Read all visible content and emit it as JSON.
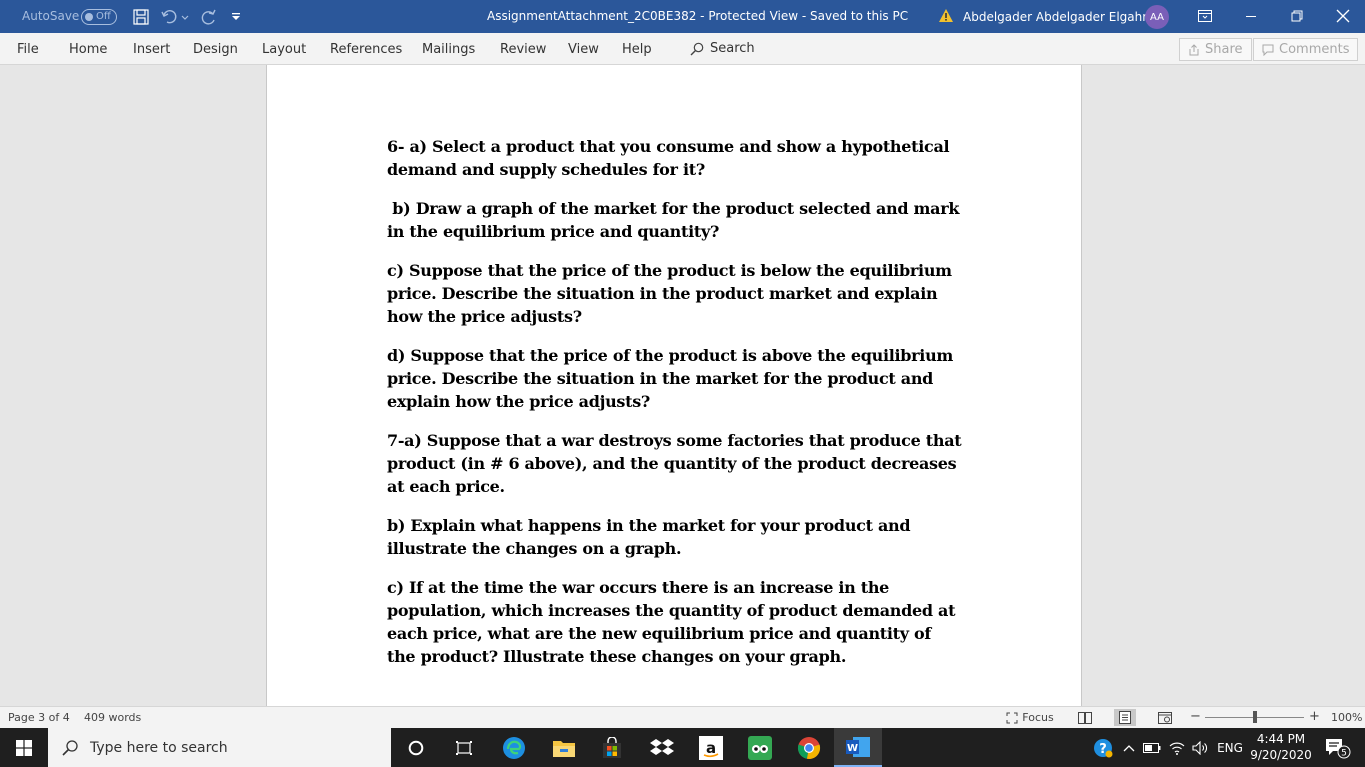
{
  "titlebar": {
    "autosave_label": "AutoSave",
    "autosave_state": "Off",
    "document_title": "AssignmentAttachment_2C0BE382  -  Protected View  -  Saved to this PC",
    "user_name": "Abdelgader Abdelgader Elgahmi",
    "user_initials": "AA"
  },
  "ribbon": {
    "tabs": [
      "File",
      "Home",
      "Insert",
      "Design",
      "Layout",
      "References",
      "Mailings",
      "Review",
      "View",
      "Help"
    ],
    "search_label": "Search",
    "share_label": "Share",
    "comments_label": "Comments"
  },
  "document": {
    "paragraphs": [
      "6- a) Select a product that you consume and show a hypothetical demand and supply schedules for it?",
      " b) Draw a graph of the market for the product selected and mark in the equilibrium price and quantity?",
      "c) Suppose that the price of the product is below the equilibrium price. Describe the situation in the product market and explain how the price adjusts?",
      "d) Suppose that the price of the product is above the equilibrium price. Describe the situation in the market for the product and explain how the price adjusts?",
      "7-a) Suppose that a war destroys some factories that produce that product (in # 6 above), and the quantity of the product decreases at each price.",
      "b) Explain what happens in the market for your product and illustrate the changes on a graph.",
      "c) If at the time the war occurs there is an increase in the population, which increases the quantity of product demanded at each price, what are the new equilibrium price and quantity of  the product? Illustrate these changes on your graph."
    ]
  },
  "statusbar": {
    "page_info": "Page 3 of 4",
    "word_count": "409 words",
    "focus_label": "Focus",
    "zoom_level": "100%",
    "zoom_fraction": 0.5
  },
  "taskbar": {
    "search_placeholder": "Type here to search",
    "language": "ENG",
    "time": "4:44 PM",
    "date": "9/20/2020",
    "notification_count": "5"
  },
  "colors": {
    "titlebar": "#2b579a",
    "ribbon": "#f3f3f3",
    "canvas": "#e6e6e6",
    "taskbar": "#1f1f1f"
  }
}
